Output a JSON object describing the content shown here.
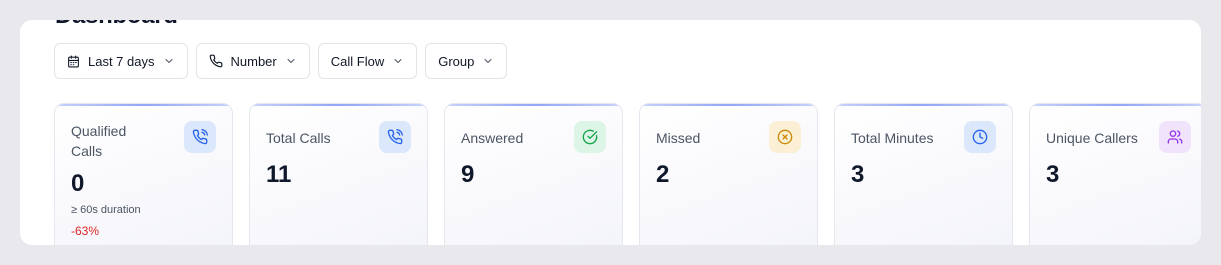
{
  "page": {
    "title": "Dashboard"
  },
  "filters": [
    {
      "label": "Last 7 days",
      "icon": "calendar-icon"
    },
    {
      "label": "Number",
      "icon": "phone-icon"
    },
    {
      "label": "Call Flow"
    },
    {
      "label": "Group"
    }
  ],
  "cards": [
    {
      "label": "Qualified Calls",
      "value": "0",
      "sub": "≥ 60s duration",
      "change": "-63%",
      "icon": "phone-call-icon",
      "icon_bg": "#dbe7fb",
      "icon_color": "#2563eb",
      "change_color": "#dc2626"
    },
    {
      "label": "Total Calls",
      "value": "11",
      "icon": "phone-call-icon",
      "icon_bg": "#dbe7fb",
      "icon_color": "#2563eb"
    },
    {
      "label": "Answered",
      "value": "9",
      "icon": "check-circle-icon",
      "icon_bg": "#dcf5e6",
      "icon_color": "#16a34a"
    },
    {
      "label": "Missed",
      "value": "2",
      "icon": "x-circle-icon",
      "icon_bg": "#fbf0d6",
      "icon_color": "#ca8a04"
    },
    {
      "label": "Total Minutes",
      "value": "3",
      "icon": "clock-icon",
      "icon_bg": "#dbe7fb",
      "icon_color": "#2563eb"
    },
    {
      "label": "Unique Callers",
      "value": "3",
      "icon": "users-icon",
      "icon_bg": "#f0e3fb",
      "icon_color": "#9333ea"
    }
  ]
}
